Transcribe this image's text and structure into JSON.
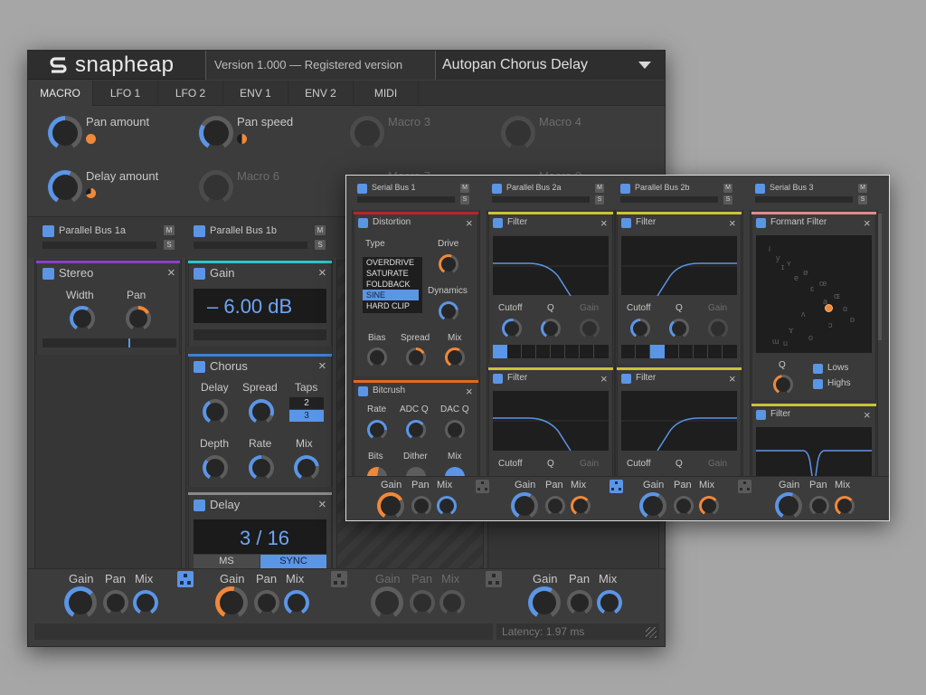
{
  "main": {
    "logo": "snapheap",
    "version": "Version 1.000 — Registered version",
    "preset": "Autopan Chorus Delay",
    "tabs": [
      "MACRO",
      "LFO 1",
      "LFO 2",
      "ENV 1",
      "ENV 2",
      "MIDI"
    ],
    "macros": [
      "Pan amount",
      "Pan speed",
      "Macro 3",
      "Macro 4",
      "Delay amount",
      "Macro 6",
      "Macro 7",
      "Macro 8"
    ],
    "buses": [
      "Parallel Bus 1a",
      "Parallel Bus 1b"
    ],
    "m": "M",
    "s": "S",
    "stereo": {
      "title": "Stereo",
      "width": "Width",
      "pan": "Pan"
    },
    "gain": {
      "title": "Gain",
      "value": "– 6.00 dB"
    },
    "chorus": {
      "title": "Chorus",
      "delay": "Delay",
      "spread": "Spread",
      "taps": "Taps",
      "tap2": "2",
      "tap3": "3",
      "depth": "Depth",
      "rate": "Rate",
      "mix": "Mix"
    },
    "delay": {
      "title": "Delay",
      "value": "3 / 16",
      "ms": "MS",
      "sync": "SYNC"
    },
    "bottom": {
      "gain": "Gain",
      "pan": "Pan",
      "mix": "Mix"
    },
    "latency": "Latency: 1.97 ms"
  },
  "front": {
    "buses": [
      "Serial Bus 1",
      "Parallel Bus 2a",
      "Parallel Bus 2b",
      "Serial Bus 3"
    ],
    "distortion": {
      "title": "Distortion",
      "type": "Type",
      "drive": "Drive",
      "options": [
        "OVERDRIVE",
        "SATURATE",
        "FOLDBACK",
        "SINE",
        "HARD CLIP"
      ],
      "selected": "SINE",
      "dynamics": "Dynamics",
      "bias": "Bias",
      "spread": "Spread",
      "mix": "Mix"
    },
    "bitcrush": {
      "title": "Bitcrush",
      "rate": "Rate",
      "adcq": "ADC Q",
      "dacq": "DAC Q",
      "bits": "Bits",
      "dither": "Dither",
      "mix": "Mix"
    },
    "filter": {
      "title": "Filter",
      "cutoff": "Cutoff",
      "q": "Q",
      "gain": "Gain"
    },
    "formant": {
      "title": "Formant Filter",
      "q": "Q",
      "lows": "Lows",
      "highs": "Highs"
    },
    "vowels": [
      "i",
      "y",
      "ɪ",
      "ʏ",
      "e",
      "ø",
      "ɛ",
      "œ",
      "a",
      "ɶ",
      "ɑ",
      "ɒ",
      "ʌ",
      "ɔ",
      "ɤ",
      "o",
      "ɯ",
      "u"
    ]
  },
  "colors": {
    "accent": "#5b95e6",
    "orange": "#f0883a",
    "bg": "#3c3c3c"
  }
}
